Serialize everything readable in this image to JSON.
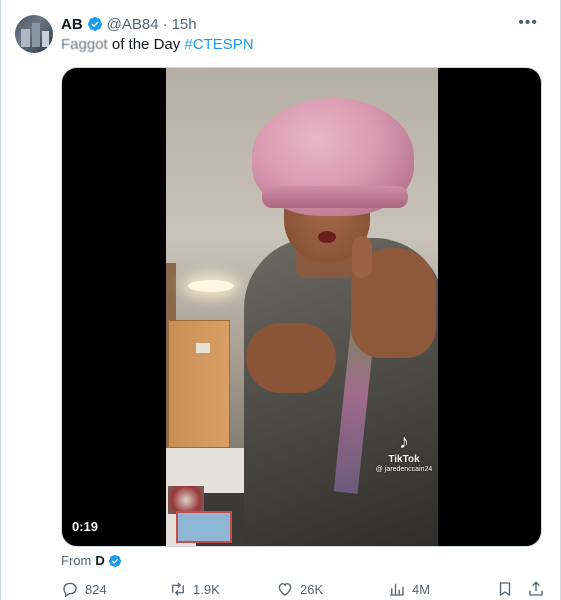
{
  "tweet": {
    "author_name": "AB",
    "author_handle": "@AB84",
    "separator": "·",
    "time": "15h",
    "more_label": "•••",
    "text_blurred": "Faggot",
    "text_plain": " of the Day ",
    "hashtag": "#CTESPN"
  },
  "media": {
    "duration": "0:19",
    "watermark_brand": "TikTok",
    "watermark_user": "@ jaredenccain24"
  },
  "source": {
    "prefix": "From",
    "name": "D"
  },
  "actions": {
    "replies": "824",
    "reposts": "1.9K",
    "likes": "26K",
    "views": "4M"
  },
  "colors": {
    "accent": "#1d9bf0",
    "secondary_text": "#536471",
    "primary_text": "#0f1419"
  },
  "icons": [
    "verified-badge-icon",
    "more-icon",
    "reply-icon",
    "repost-icon",
    "like-icon",
    "views-icon",
    "bookmark-icon",
    "share-icon",
    "tiktok-logo-icon"
  ]
}
